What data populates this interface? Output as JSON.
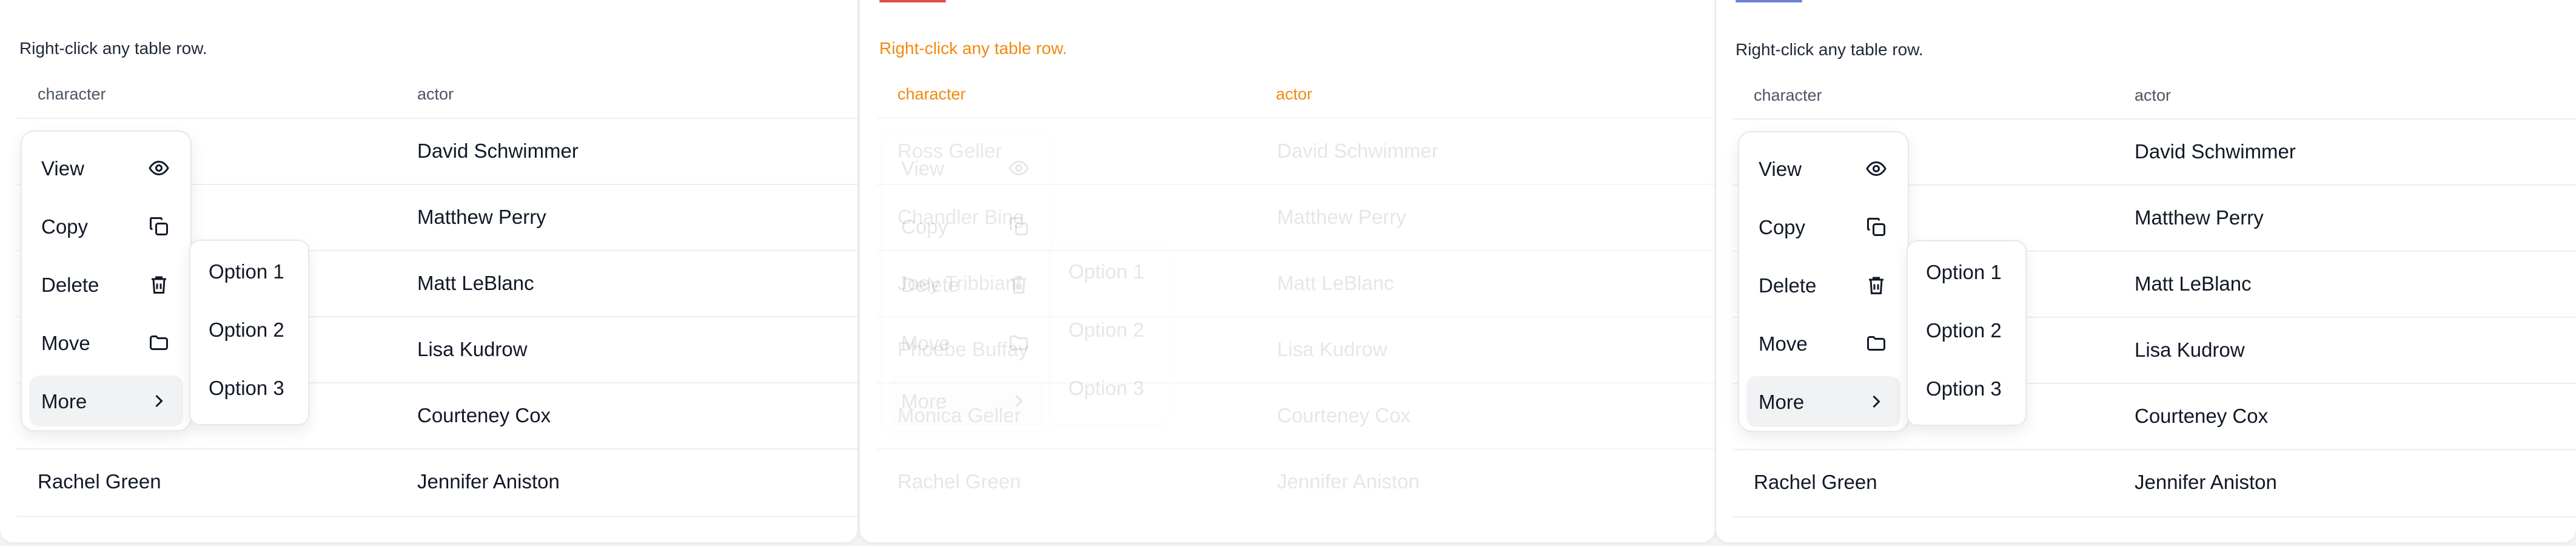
{
  "hint": "Right-click any table row.",
  "headers": {
    "character": "character",
    "actor": "actor"
  },
  "rows": [
    {
      "character": "Ross Geller",
      "actor": "David Schwimmer"
    },
    {
      "character": "Chandler Bing",
      "actor": "Matthew Perry"
    },
    {
      "character": "Joey Tribbiani",
      "actor": "Matt LeBlanc"
    },
    {
      "character": "Phoebe Buffay",
      "actor": "Lisa Kudrow"
    },
    {
      "character": "Monica Geller",
      "actor": "Courteney Cox"
    },
    {
      "character": "Rachel Green",
      "actor": "Jennifer Aniston"
    }
  ],
  "menu": {
    "items": [
      {
        "label": "View",
        "icon": "eye-icon"
      },
      {
        "label": "Copy",
        "icon": "copy-icon"
      },
      {
        "label": "Delete",
        "icon": "trash-icon"
      },
      {
        "label": "Move",
        "icon": "folder-icon"
      },
      {
        "label": "More",
        "icon": "chevron-right-icon"
      }
    ],
    "active_index": 4
  },
  "submenu": {
    "options": [
      "Option 1",
      "Option 2",
      "Option 3"
    ]
  },
  "colors": {
    "accent_red": "#e24b4b",
    "accent_blue": "#6f7fd6",
    "hint_orange": "#f08a10"
  }
}
